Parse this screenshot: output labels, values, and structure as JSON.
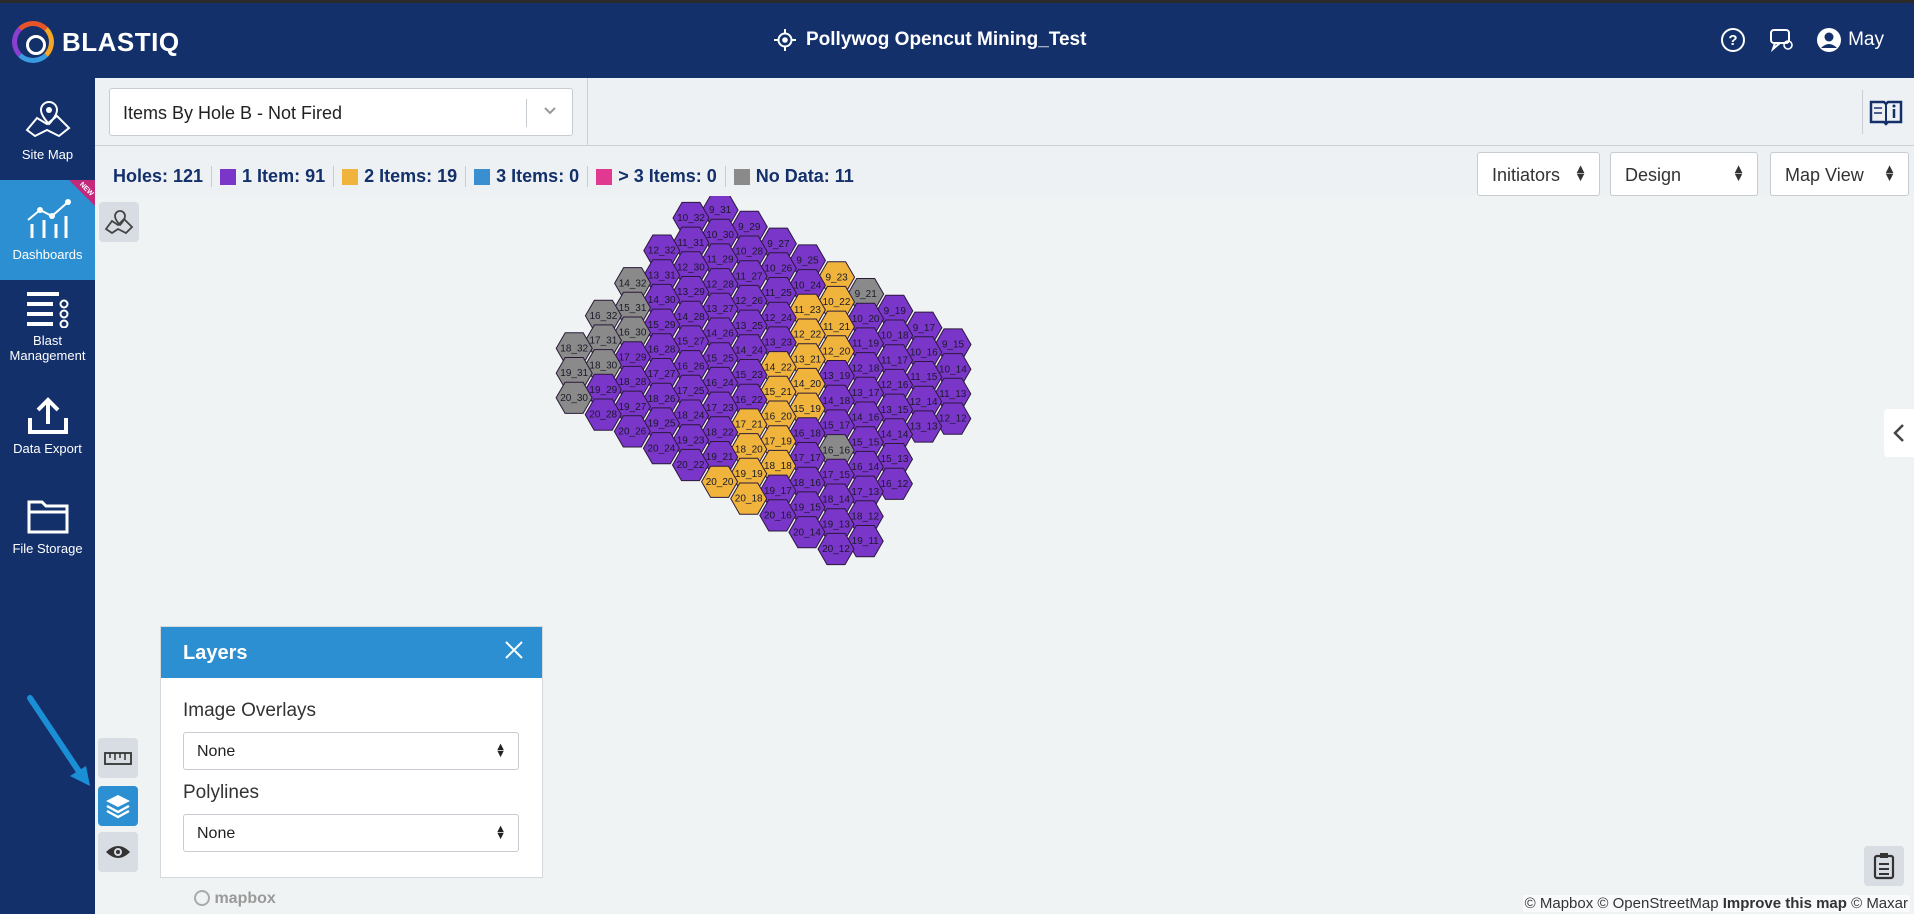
{
  "app": {
    "name": "BLASTIQ"
  },
  "header": {
    "site_title": "Pollywog Opencut Mining_Test",
    "user": "May",
    "icons": [
      "help-icon",
      "chat-icon",
      "user-avatar-icon",
      "target-icon"
    ]
  },
  "sidebar": {
    "items": [
      {
        "label": "Site Map",
        "icon": "map-pin-icon"
      },
      {
        "label": "Dashboards",
        "icon": "chart-icon",
        "badge": "NEW"
      },
      {
        "label": "Blast Management",
        "icon": "list-icon"
      },
      {
        "label": "Data Export",
        "icon": "upload-icon"
      },
      {
        "label": "File Storage",
        "icon": "folder-icon"
      }
    ]
  },
  "filter": {
    "value": "Items By Hole B - Not Fired"
  },
  "stats": {
    "holes": "Holes: 121",
    "one": "1 Item: 91",
    "two": "2 Items: 19",
    "three": "3 Items: 0",
    "more": "> 3 Items: 0",
    "nodata": "No Data: 11"
  },
  "colors": {
    "one_item": "#7a35c9",
    "two_items": "#f0b43c",
    "three_items": "#3a8fd0",
    "more_items": "#e0398f",
    "no_data": "#8a8a8a",
    "nav_bg": "#13306b",
    "accent": "#2b8fd1"
  },
  "dropdowns": {
    "initiators": "Initiators",
    "design": "Design",
    "map_view": "Map View"
  },
  "layers": {
    "title": "Layers",
    "image_overlays_label": "Image Overlays",
    "image_overlays_value": "None",
    "polylines_label": "Polylines",
    "polylines_value": "None"
  },
  "attribution": {
    "mapbox": "© Mapbox",
    "osm": "© OpenStreetMap",
    "improve": "Improve this map",
    "maxar": "© Maxar",
    "logo": "mapbox"
  },
  "holes": {
    "yellow": [
      "9_23",
      "10_22",
      "11_23",
      "11_21",
      "12_22",
      "12_20",
      "13_21",
      "14_22",
      "14_20",
      "15_21",
      "15_19",
      "16_20",
      "17_21",
      "17_19",
      "18_20",
      "18_18",
      "19_19",
      "20_20",
      "20_18"
    ],
    "grey": [
      "9_21",
      "14_32",
      "15_31",
      "16_32",
      "16_30",
      "17_31",
      "18_32",
      "18_30",
      "19_31",
      "20_30",
      "16_16"
    ]
  }
}
